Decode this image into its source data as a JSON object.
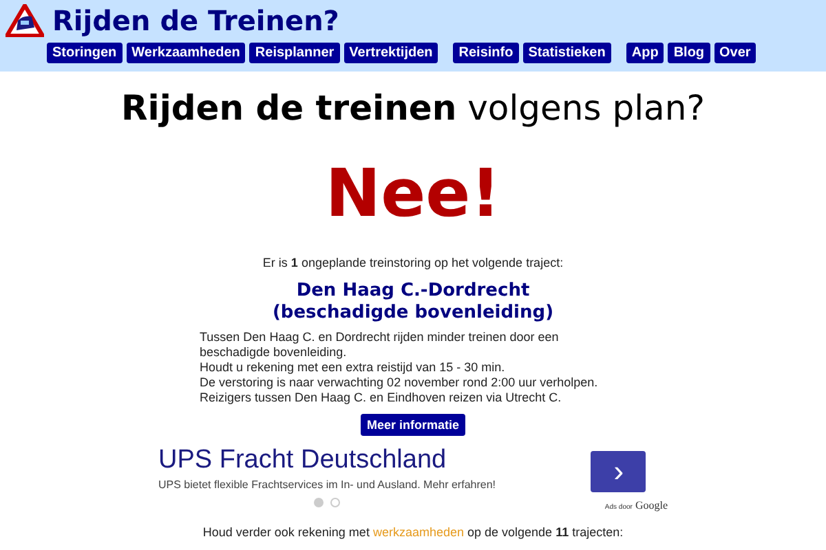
{
  "header": {
    "title": "Rijden de Treinen?",
    "nav_groups": [
      [
        {
          "label": "Storingen"
        },
        {
          "label": "Werkzaamheden"
        },
        {
          "label": "Reisplanner"
        },
        {
          "label": "Vertrektijden"
        }
      ],
      [
        {
          "label": "Reisinfo"
        },
        {
          "label": "Statistieken"
        }
      ],
      [
        {
          "label": "App"
        },
        {
          "label": "Blog"
        },
        {
          "label": "Over"
        }
      ]
    ]
  },
  "headline": "**Rijden de treinen** volgens plan?",
  "answer": "Nee!",
  "intro": "Er is **1** ongeplande treinstoring op het volgende traject:",
  "disruption": {
    "title": [
      "Den Haag C.-Dordrecht",
      "(beschadigde bovenleiding)"
    ],
    "lines": [
      "Tussen Den Haag C. en Dordrecht rijden minder treinen door een beschadigde bovenleiding.",
      "Houdt u rekening met een extra reistijd van 15 - 30 min.",
      "De verstoring is naar verwachting 02 november rond 2:00 uur verholpen.",
      "Reizigers tussen Den Haag C. en Eindhoven reizen via Utrecht C."
    ],
    "button": "Meer informatie"
  },
  "ad": {
    "title": "UPS Fracht Deutschland",
    "text": "UPS bietet flexible Frachtservices im In- und Ausland. Mehr erfahren!",
    "button": "›",
    "dots": [
      {
        "selected": true
      },
      {
        "selected": false
      }
    ],
    "attribution": "Ads door",
    "brand": "Google"
  },
  "notice": {
    "before": "Houd verder ook rekening met",
    "link": "werkzaamheden",
    "after": "op de volgende **11** trajecten:"
  }
}
